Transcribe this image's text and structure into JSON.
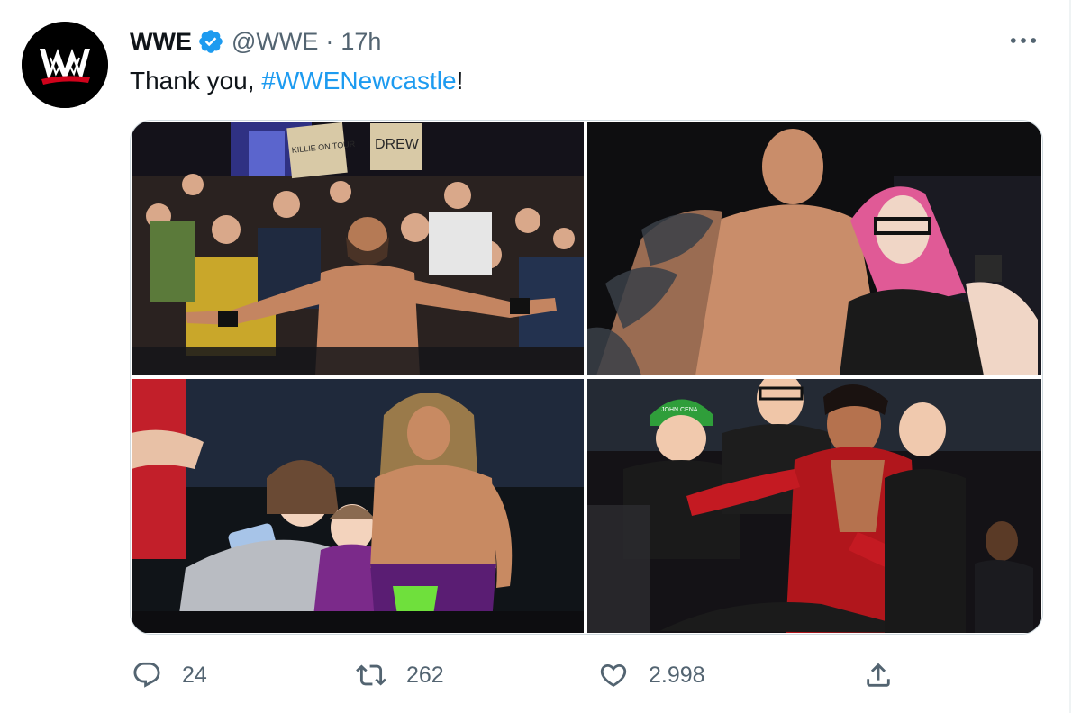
{
  "tweet": {
    "author_name": "WWE",
    "handle": "@WWE",
    "separator": "·",
    "time": "17h",
    "text_prefix": "Thank you, ",
    "hashtag": "#WWENewcastle",
    "text_suffix": "!"
  },
  "media": {
    "photos": [
      {
        "sign_1": "KILLIE ON TOUR",
        "sign_2": "DREW"
      },
      {},
      {},
      {
        "cap_text": "JOHN CENA"
      }
    ]
  },
  "actions": {
    "reply_count": "24",
    "retweet_count": "262",
    "like_count": "2.998"
  },
  "icons": {
    "avatar": "wwe-logo",
    "verified": "verified-badge-icon",
    "more": "more-options-icon",
    "reply": "reply-icon",
    "retweet": "retweet-icon",
    "like": "heart-icon",
    "share": "share-icon"
  },
  "colors": {
    "accent": "#1d9bf0",
    "text_primary": "#0f1419",
    "text_secondary": "#536471",
    "border": "#cfd9de"
  }
}
